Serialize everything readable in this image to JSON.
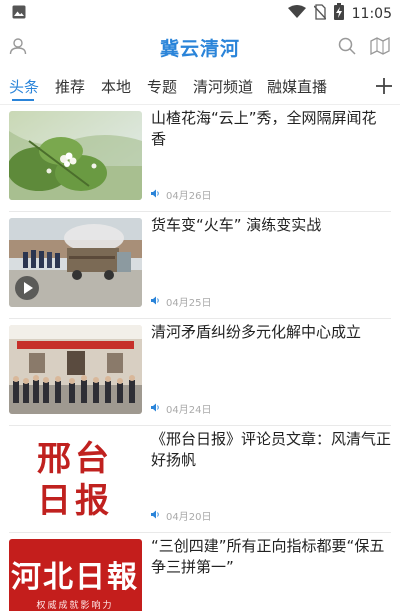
{
  "status_bar": {
    "time": "11:05",
    "icons": [
      "image-icon",
      "wifi-icon",
      "no-sim-icon",
      "battery-charging-icon"
    ]
  },
  "header": {
    "title": "冀云清河",
    "icons": [
      "user-icon",
      "search-icon",
      "map-icon"
    ]
  },
  "tabs": [
    {
      "label": "头条",
      "active": true
    },
    {
      "label": "推荐",
      "active": false
    },
    {
      "label": "本地",
      "active": false
    },
    {
      "label": "专题",
      "active": false
    },
    {
      "label": "清河频道",
      "active": false
    },
    {
      "label": "融媒直播",
      "active": false
    }
  ],
  "add_tab_icon": "plus-icon",
  "colors": {
    "accent": "#2a84d9",
    "date_text": "#aaaaaa"
  },
  "feed": [
    {
      "title": "山楂花海“云上”秀，全网隔屏闻花香",
      "date": "04月26日",
      "thumb": "hawthorn-flower-photo",
      "video": false
    },
    {
      "title": "货车变“火车” 演练变实战",
      "date": "04月25日",
      "thumb": "truck-fire-drill-photo",
      "video": true
    },
    {
      "title": "清河矛盾纠纷多元化解中心成立",
      "date": "04月24日",
      "thumb": "crowd-building-ceremony-photo",
      "video": false
    },
    {
      "title": "《邢台日报》评论员文章：风清气正好扬帆",
      "date": "04月20日",
      "thumb": "xingtai-daily-logo",
      "thumb_text": "邢台日报",
      "video": false
    },
    {
      "title": "“三创四建”所有正向指标都要“保五争三拼第一”",
      "date": "",
      "thumb": "hebei-daily-logo",
      "thumb_text": "河北日报",
      "thumb_subtext": "权威成就影响力",
      "video": false
    }
  ]
}
